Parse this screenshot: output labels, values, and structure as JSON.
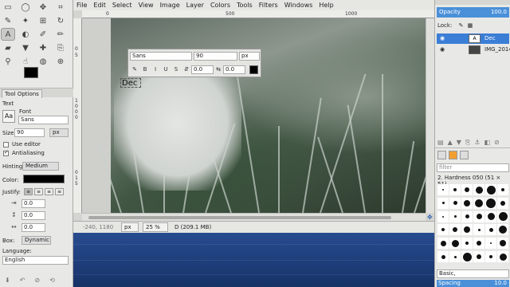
{
  "menu": [
    "File",
    "Edit",
    "Select",
    "View",
    "Image",
    "Layer",
    "Colors",
    "Tools",
    "Filters",
    "Windows",
    "Help"
  ],
  "toolbox": {
    "tools": [
      {
        "name": "rect-select-icon",
        "glyph": "▭"
      },
      {
        "name": "ellipse-select-icon",
        "glyph": "◯"
      },
      {
        "name": "move-icon",
        "glyph": "✥"
      },
      {
        "name": "crop-icon",
        "glyph": "⌗"
      },
      {
        "name": "free-select-icon",
        "glyph": "✎"
      },
      {
        "name": "fuzzy-select-icon",
        "glyph": "✦"
      },
      {
        "name": "align-icon",
        "glyph": "⊞"
      },
      {
        "name": "rotate-icon",
        "glyph": "↻"
      },
      {
        "name": "text-tool-icon",
        "glyph": "A",
        "active": true
      },
      {
        "name": "foreground-select-icon",
        "glyph": "◐"
      },
      {
        "name": "paintbrush-icon",
        "glyph": "✐"
      },
      {
        "name": "pencil-icon",
        "glyph": "✏"
      },
      {
        "name": "eraser-icon",
        "glyph": "▰"
      },
      {
        "name": "bucket-fill-icon",
        "glyph": "▼"
      },
      {
        "name": "heal-icon",
        "glyph": "✚"
      },
      {
        "name": "clone-icon",
        "glyph": "⎘"
      },
      {
        "name": "color-picker-icon",
        "glyph": "⚲"
      },
      {
        "name": "smudge-icon",
        "glyph": "☝"
      },
      {
        "name": "dodge-icon",
        "glyph": "◍"
      },
      {
        "name": "zoom-icon",
        "glyph": "⊕"
      }
    ],
    "tab": "Tool Options",
    "section": "Text",
    "font_label": "Font",
    "font_value": "Sans",
    "size_label": "Size:",
    "size_value": "90",
    "size_unit": "px",
    "use_editor": "Use editor",
    "antialiasing": "Antialiasing",
    "hinting_label": "Hinting:",
    "hinting_value": "Medium",
    "color_label": "Color:",
    "justify_label": "Justify:",
    "indent_value": "0.0",
    "line_spacing_value": "0.0",
    "letter_spacing_value": "0.0",
    "box_label": "Box:",
    "box_value": "Dynamic",
    "language_label": "Language:",
    "language_value": "English"
  },
  "canvas": {
    "overlay_font": "Sans",
    "overlay_size": "90",
    "overlay_unit": "px",
    "overlay_baseline": "0.0",
    "overlay_kerning": "0.0",
    "text": "Dec"
  },
  "ruler": {
    "top": [
      "0",
      "500",
      "1000"
    ],
    "left": [
      "0",
      "5",
      "1",
      "0",
      "0",
      "0",
      "0",
      "1",
      "5"
    ]
  },
  "status": {
    "coords": "-240, 1180",
    "unit": "px",
    "zoom": "25 %",
    "info": "D (209.1 MB)"
  },
  "layers": {
    "opacity_label": "Opacity",
    "opacity_value": "100.0",
    "lock_label": "Lock:",
    "items": [
      {
        "name": "Dec",
        "selected": true
      },
      {
        "name": "IMG_20141",
        "selected": false
      }
    ]
  },
  "brushes": {
    "filter_placeholder": "filter",
    "current": "2. Hardness 050 (51 × 51)",
    "preset": "Basic,",
    "spacing_label": "Spacing",
    "spacing_value": "10.0"
  }
}
